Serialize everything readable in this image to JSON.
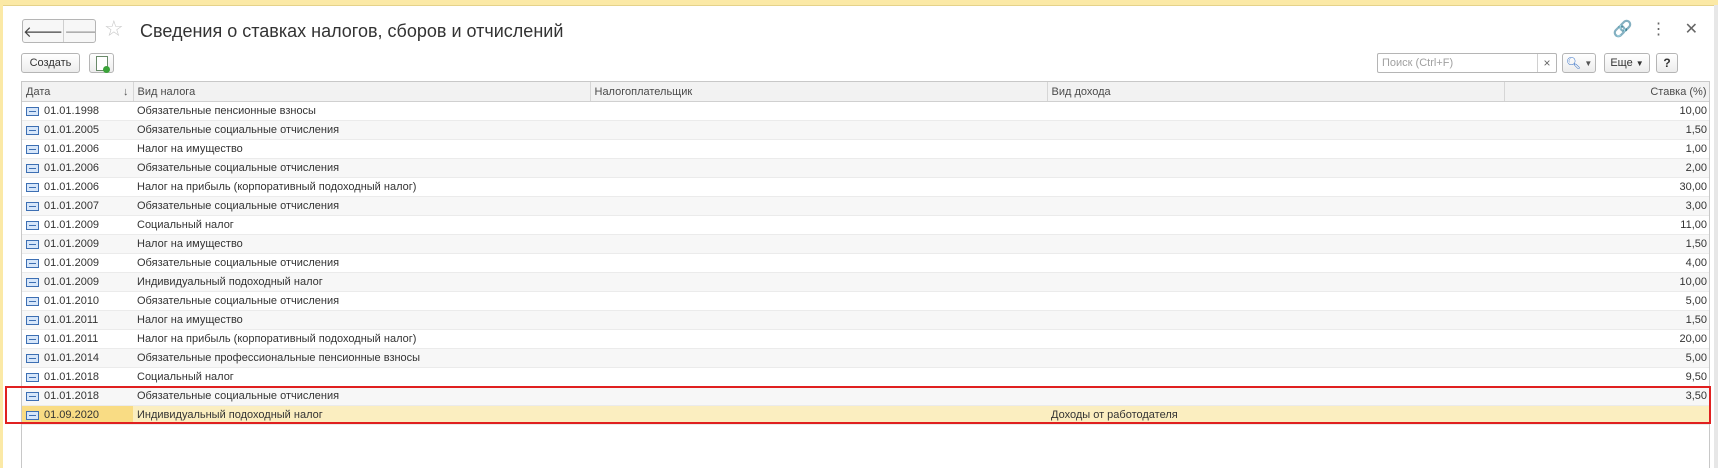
{
  "window": {
    "title": "Сведения о ставках налогов, сборов и отчислений"
  },
  "toolbar": {
    "create_label": "Создать",
    "search_placeholder": "Поиск (Ctrl+F)",
    "more_label": "Еще",
    "help_label": "?"
  },
  "table": {
    "columns": {
      "date": "Дата",
      "tax_type": "Вид налога",
      "taxpayer": "Налогоплательщик",
      "income_type": "Вид дохода",
      "rate": "Ставка (%)"
    },
    "rows": [
      {
        "date": "01.01.1998",
        "tax_type": "Обязательные пенсионные взносы",
        "taxpayer": "",
        "income_type": "",
        "rate": "10,00"
      },
      {
        "date": "01.01.2005",
        "tax_type": "Обязательные социальные отчисления",
        "taxpayer": "",
        "income_type": "",
        "rate": "1,50"
      },
      {
        "date": "01.01.2006",
        "tax_type": "Налог на имущество",
        "taxpayer": "",
        "income_type": "",
        "rate": "1,00"
      },
      {
        "date": "01.01.2006",
        "tax_type": "Обязательные социальные отчисления",
        "taxpayer": "",
        "income_type": "",
        "rate": "2,00"
      },
      {
        "date": "01.01.2006",
        "tax_type": "Налог на прибыль (корпоративный подоходный налог)",
        "taxpayer": "",
        "income_type": "",
        "rate": "30,00"
      },
      {
        "date": "01.01.2007",
        "tax_type": "Обязательные социальные отчисления",
        "taxpayer": "",
        "income_type": "",
        "rate": "3,00"
      },
      {
        "date": "01.01.2009",
        "tax_type": "Социальный налог",
        "taxpayer": "",
        "income_type": "",
        "rate": "11,00"
      },
      {
        "date": "01.01.2009",
        "tax_type": "Налог на имущество",
        "taxpayer": "",
        "income_type": "",
        "rate": "1,50"
      },
      {
        "date": "01.01.2009",
        "tax_type": "Обязательные социальные отчисления",
        "taxpayer": "",
        "income_type": "",
        "rate": "4,00"
      },
      {
        "date": "01.01.2009",
        "tax_type": "Индивидуальный подоходный налог",
        "taxpayer": "",
        "income_type": "",
        "rate": "10,00"
      },
      {
        "date": "01.01.2010",
        "tax_type": "Обязательные социальные отчисления",
        "taxpayer": "",
        "income_type": "",
        "rate": "5,00"
      },
      {
        "date": "01.01.2011",
        "tax_type": "Налог на имущество",
        "taxpayer": "",
        "income_type": "",
        "rate": "1,50"
      },
      {
        "date": "01.01.2011",
        "tax_type": "Налог на прибыль (корпоративный подоходный налог)",
        "taxpayer": "",
        "income_type": "",
        "rate": "20,00"
      },
      {
        "date": "01.01.2014",
        "tax_type": "Обязательные профессиональные пенсионные взносы",
        "taxpayer": "",
        "income_type": "",
        "rate": "5,00"
      },
      {
        "date": "01.01.2018",
        "tax_type": "Социальный налог",
        "taxpayer": "",
        "income_type": "",
        "rate": "9,50"
      },
      {
        "date": "01.01.2018",
        "tax_type": "Обязательные социальные отчисления",
        "taxpayer": "",
        "income_type": "",
        "rate": "3,50"
      },
      {
        "date": "01.09.2020",
        "tax_type": "Индивидуальный подоходный налог",
        "taxpayer": "",
        "income_type": "Доходы от работодателя",
        "rate": ""
      }
    ],
    "selected_row_index": 16
  },
  "colors": {
    "selection": "#fbeec0",
    "highlight_border": "#e02020"
  }
}
